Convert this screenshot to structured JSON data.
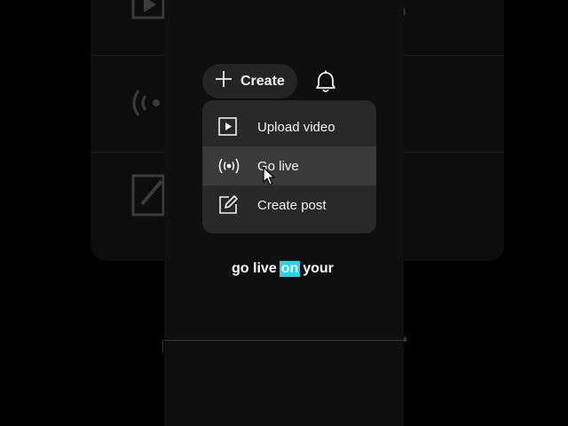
{
  "header": {
    "create_label": "Create",
    "create_icon": "plus-icon",
    "notifications_icon": "bell-icon"
  },
  "menu": {
    "items": [
      {
        "label": "Upload video",
        "icon": "play-box-icon"
      },
      {
        "label": "Go live",
        "icon": "broadcast-icon",
        "hovered": true
      },
      {
        "label": "Create post",
        "icon": "edit-post-icon"
      }
    ]
  },
  "caption": {
    "words": [
      "go live",
      "on",
      "your"
    ],
    "highlight_color": "#20d4ea"
  },
  "colors": {
    "menu_bg": "#282828",
    "menu_hover": "#3a3a3a",
    "button_bg": "#242424",
    "text": "#f1f1f1"
  }
}
